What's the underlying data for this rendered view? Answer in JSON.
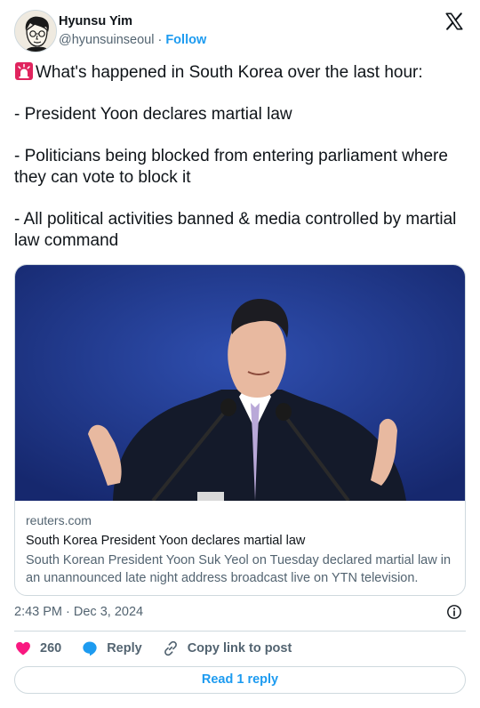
{
  "author": {
    "name": "Hyunsu Yim",
    "handle": "@hyunsuinseoul",
    "separator": " · ",
    "follow_label": "Follow"
  },
  "tweet": {
    "lines": [
      "What's happened in South Korea over the last hour:",
      "- President Yoon declares martial law",
      "- Politicians being blocked from entering parliament where they can vote to block it",
      "- All political activities banned & media controlled by martial law command"
    ],
    "lead_emoji": "siren-icon"
  },
  "link_card": {
    "domain": "reuters.com",
    "title": "South Korea President Yoon declares martial law",
    "description": "South Korean President Yoon Suk Yeol on Tuesday declared martial law in an unannounced late night address broadcast live on YTN television."
  },
  "timestamp": "2:43 PM · Dec 3, 2024",
  "actions": {
    "like_count": "260",
    "reply_label": "Reply",
    "copy_label": "Copy link to post"
  },
  "read_reply_label": "Read 1 reply",
  "colors": {
    "accent": "#1d9bf0",
    "like": "#f91880",
    "text": "#0f1419",
    "muted": "#536471",
    "border": "#cfd9de"
  }
}
